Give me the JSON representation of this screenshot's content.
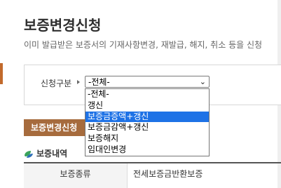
{
  "header": {
    "title": "보증변경신청",
    "description": "이미 발급받은 보증서의 기재사항변경, 재발급, 해지, 취소 등을 신청"
  },
  "form": {
    "type_label": "신청구분",
    "select": {
      "value": "-전체-",
      "options": [
        "-전체-",
        "갱신",
        "보증금증액+갱신",
        "보증금감액+갱신",
        "보증해지",
        "임대인변경"
      ],
      "highlighted_index": 2
    }
  },
  "button": {
    "label": "보증변경신청"
  },
  "section": {
    "title": "보증내역"
  },
  "table": {
    "header": "보증종류",
    "value": "전세보증금반환보증"
  },
  "colors": {
    "button_bg": "#a66b3d",
    "highlight": "#1e72e6",
    "icon_green": "#3aa35b",
    "icon_blue": "#2d6fb7"
  }
}
